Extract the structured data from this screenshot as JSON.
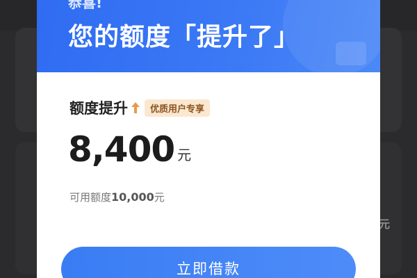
{
  "background": {
    "right_fragment": "元"
  },
  "modal": {
    "subtitle": "恭喜!",
    "title": "您的额度「提升了」",
    "label": "额度提升",
    "badge": "优质用户专享",
    "amount": "8,400",
    "amount_unit": "元",
    "available_prefix": "可用额度",
    "available_amount": "10,000",
    "available_unit": "元",
    "button_label": "立即借款",
    "icons": [
      "arrow-up-icon"
    ],
    "colors": {
      "header_blue": "#2f6cf2",
      "button_blue": "#3a7cf4",
      "badge_bg": "#fbe7d0",
      "badge_text": "#8a5520"
    }
  }
}
